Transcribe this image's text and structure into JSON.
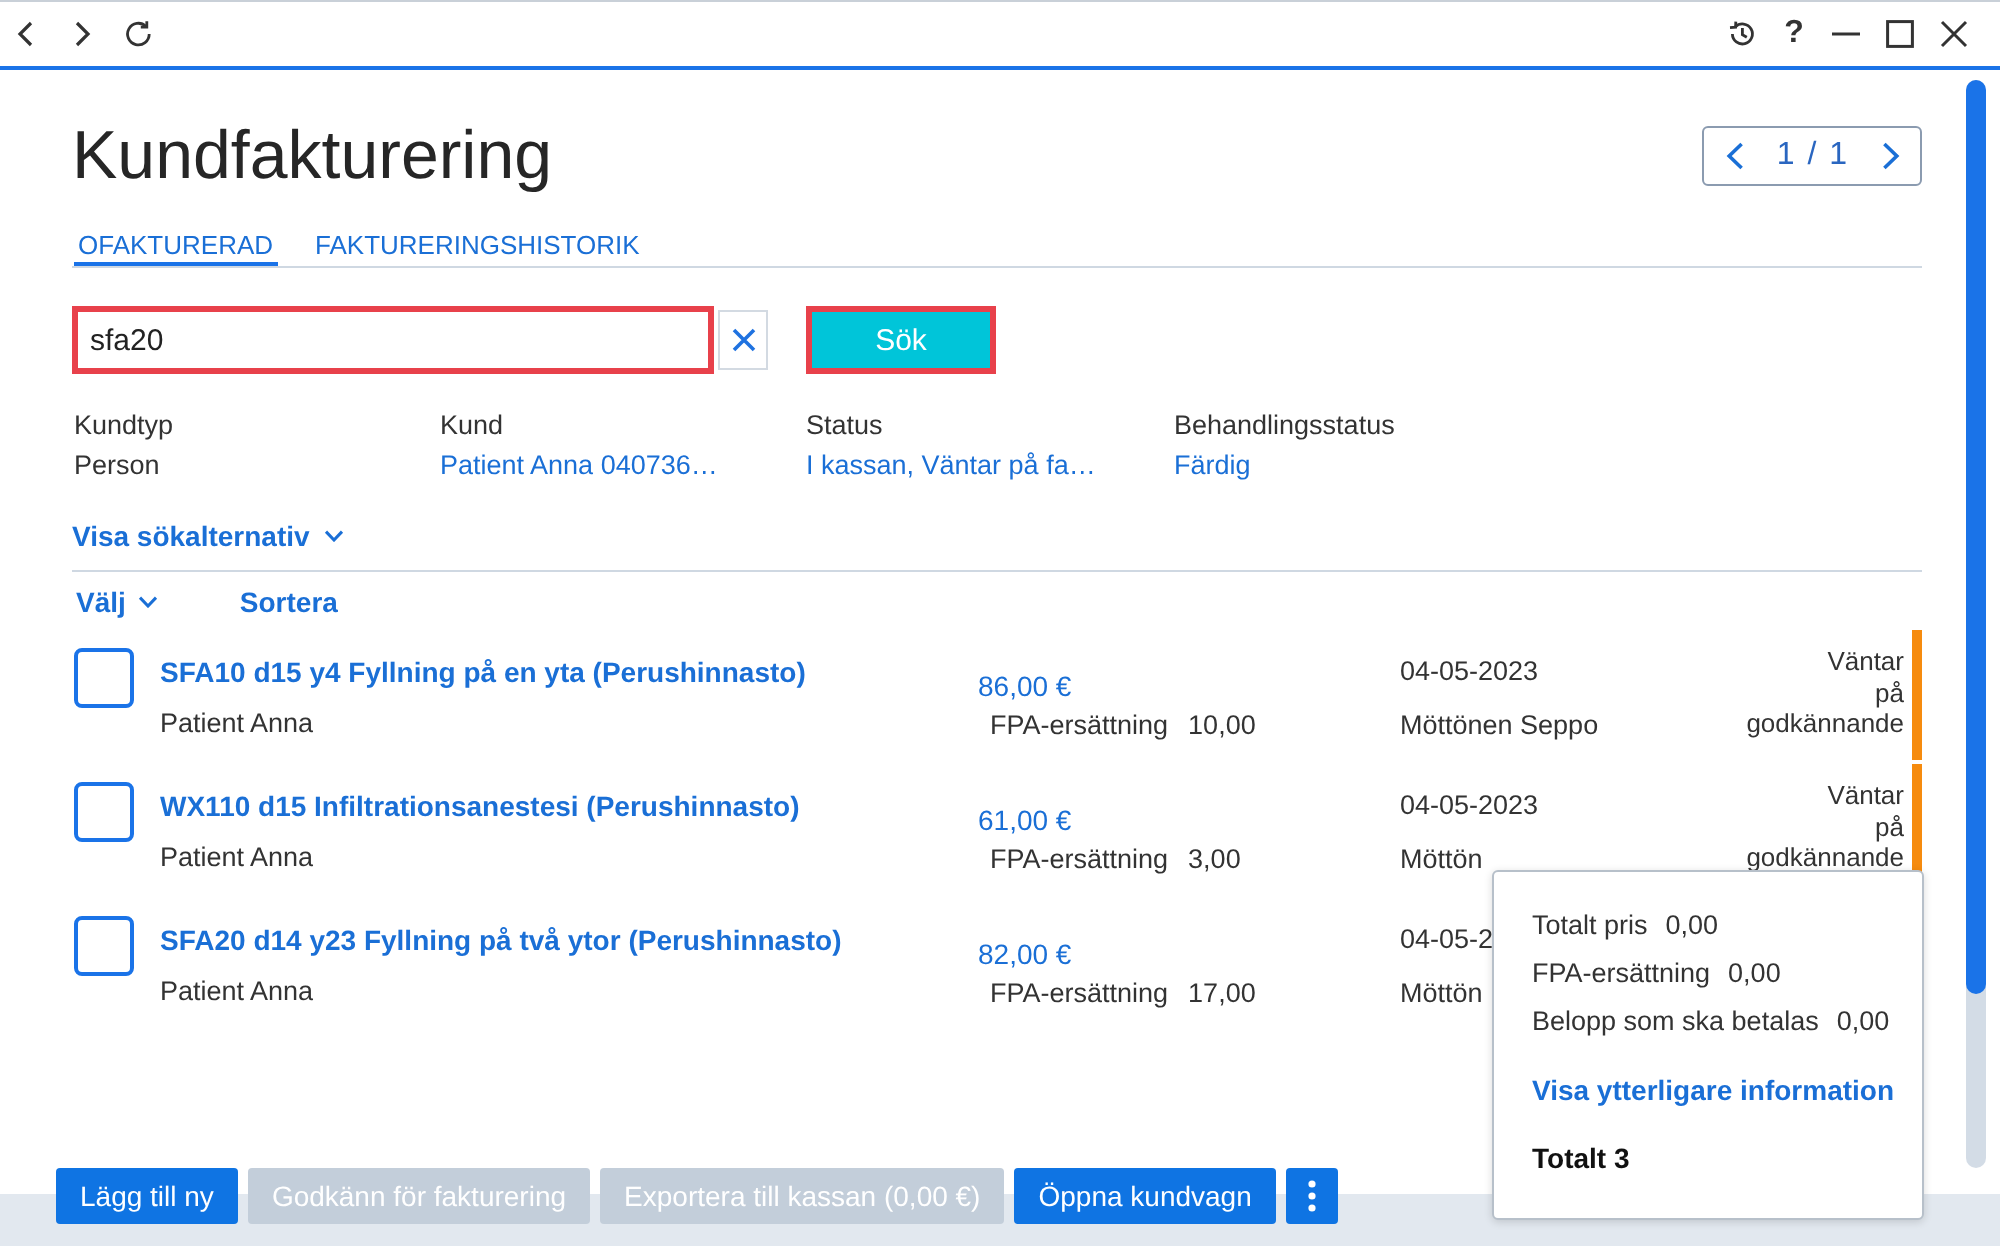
{
  "titlebar": {
    "help": "?"
  },
  "page": {
    "title": "Kundfakturering",
    "pager": "1 / 1"
  },
  "tabs": [
    {
      "label": "OFAKTURERAD",
      "selected": true
    },
    {
      "label": "FAKTURERINGSHISTORIK",
      "selected": false
    }
  ],
  "search": {
    "value": "sfa20",
    "highlighted": true
  },
  "search_button": {
    "label": "Sök",
    "highlighted": true
  },
  "filters": [
    {
      "label": "Kundtyp",
      "value": "Person",
      "link": false
    },
    {
      "label": "Kund",
      "value": "Patient Anna 040736…",
      "link": true
    },
    {
      "label": "Status",
      "value": "I kassan, Väntar på fa…",
      "link": true
    },
    {
      "label": "Behandlingsstatus",
      "value": "Färdig",
      "link": true
    }
  ],
  "search_options": {
    "label": "Visa sökalternativ",
    "expanded": false
  },
  "list_toolbar": {
    "select": "Välj",
    "sort": "Sortera"
  },
  "rows": [
    {
      "title": "SFA10 d15 y4 Fyllning på en yta (Perushinnasto)",
      "patient": "Patient Anna",
      "price": "86,00 €",
      "reimbursement_label": "FPA-ersättning",
      "reimbursement": "10,00",
      "date": "04-05-2023",
      "doctor": "Möttönen Seppo",
      "status": "Väntar på godkännande",
      "color": "#f68b0e",
      "checked": false
    },
    {
      "title": "WX110 d15 Infiltrationsanestesi (Perushinnasto)",
      "patient": "Patient Anna",
      "price": "61,00 €",
      "reimbursement_label": "FPA-ersättning",
      "reimbursement": "3,00",
      "date": "04-05-2023",
      "doctor": "Möttön",
      "status": "Väntar på godkännande",
      "color": "#f68b0e",
      "checked": false
    },
    {
      "title": "SFA20 d14 y23 Fyllning på två ytor (Perushinnasto)",
      "patient": "Patient Anna",
      "price": "82,00 €",
      "reimbursement_label": "FPA-ersättning",
      "reimbursement": "17,00",
      "date": "04-05-2",
      "doctor": "Möttön",
      "checked": false
    }
  ],
  "summary": {
    "lines": [
      {
        "label": "Totalt pris",
        "value": "0,00"
      },
      {
        "label": "FPA-ersättning",
        "value": "0,00"
      },
      {
        "label": "Belopp som ska betalas",
        "value": "0,00"
      }
    ],
    "link": "Visa ytterligare information",
    "total": "Totalt 3"
  },
  "actions": [
    {
      "label": "Lägg till ny",
      "disabled": false
    },
    {
      "label": "Godkänn för fakturering",
      "disabled": true
    },
    {
      "label": "Exportera till kassan (0,00 €)",
      "disabled": true
    },
    {
      "label": "Öppna kundvagn",
      "disabled": false
    }
  ]
}
